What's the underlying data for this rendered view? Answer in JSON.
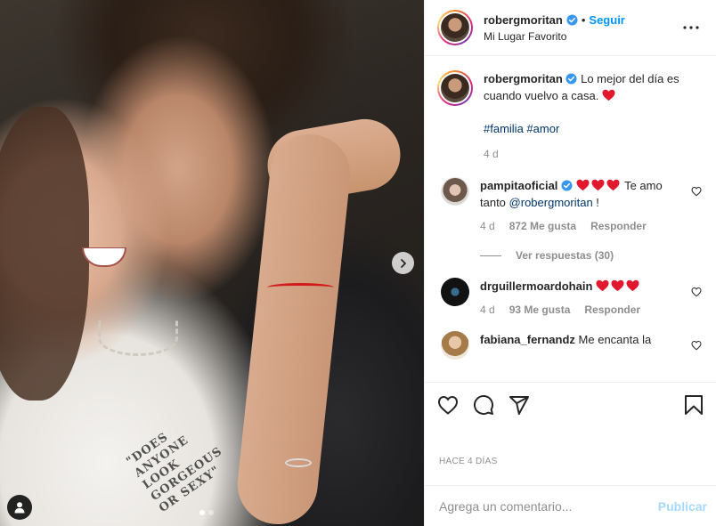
{
  "header": {
    "username": "robergmoritan",
    "follow_label": "Seguir",
    "location": "Mi Lugar Favorito"
  },
  "caption": {
    "username": "robergmoritan",
    "text": "Lo mejor del día es cuando vuelvo a casa.",
    "hashtag_1": "#familia",
    "hashtag_2": "#amor",
    "time": "4 d"
  },
  "comments": [
    {
      "username": "pampitaoficial",
      "text": "Te amo tanto",
      "mention": "@robergmoritan",
      "suffix": "!",
      "time": "4 d",
      "likes": "872 Me gusta",
      "reply_label": "Responder",
      "view_replies": "Ver respuestas (30)"
    },
    {
      "username": "drguillermoardohain",
      "time": "4 d",
      "likes": "93 Me gusta",
      "reply_label": "Responder"
    },
    {
      "username": "fabiana_fernandz",
      "text": "Me encanta la"
    }
  ],
  "post_date": "HACE 4 DÍAS",
  "comment_box": {
    "placeholder": "Agrega un comentario...",
    "publish_label": "Publicar"
  },
  "photo": {
    "shirt_text": "\"DOES ANYONE LOOK GORGEOUS OR SEXY\""
  },
  "colors": {
    "accent": "#0095f6",
    "heart_red": "#ed4956",
    "verified_blue": "#3897f0",
    "muted": "#8e8e8e",
    "text": "#262626"
  },
  "icons": [
    "verified-badge-icon",
    "more-options-icon",
    "heart-icon",
    "comment-icon",
    "share-icon",
    "bookmark-icon",
    "chevron-right-icon",
    "user-tag-icon"
  ]
}
